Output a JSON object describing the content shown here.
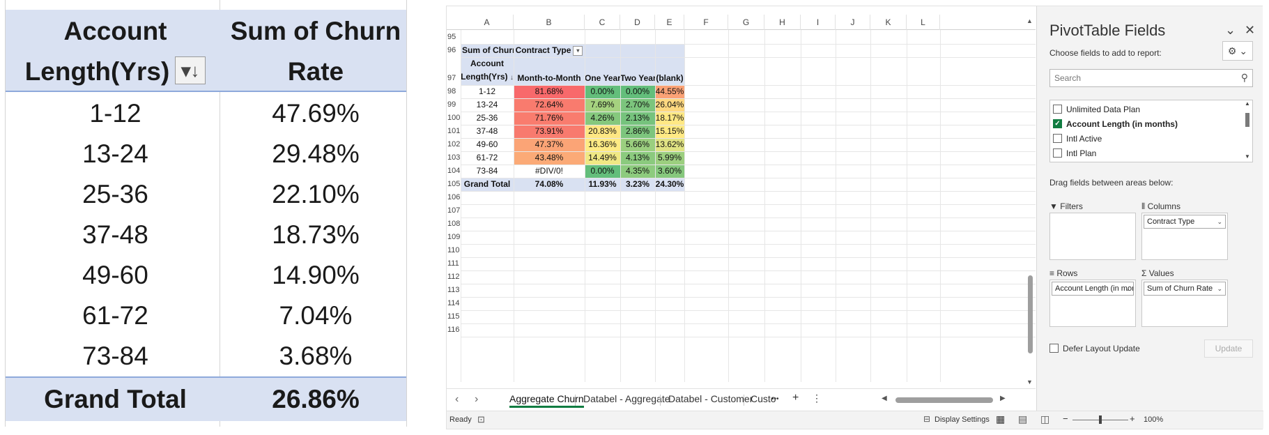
{
  "left_pivot": {
    "header_col1": "Account Length(Yrs)",
    "header_col1_line1": "Account",
    "header_col1_line2": "Length(Yrs)",
    "header_col2_line1": "Sum of Churn",
    "header_col2_line2": "Rate",
    "sort_icon": "sort-descending-icon",
    "rows": [
      {
        "label": "1-12",
        "value": "47.69%"
      },
      {
        "label": "13-24",
        "value": "29.48%"
      },
      {
        "label": "25-36",
        "value": "22.10%"
      },
      {
        "label": "37-48",
        "value": "18.73%"
      },
      {
        "label": "49-60",
        "value": "14.90%"
      },
      {
        "label": "61-72",
        "value": "7.04%"
      },
      {
        "label": "73-84",
        "value": "3.68%"
      }
    ],
    "total_label": "Grand Total",
    "total_value": "26.86%"
  },
  "excel": {
    "columns": [
      "A",
      "B",
      "C",
      "D",
      "E",
      "F",
      "G",
      "H",
      "I",
      "J",
      "K",
      "L"
    ],
    "row_numbers": [
      "95",
      "96",
      "97",
      "98",
      "99",
      "100",
      "101",
      "102",
      "103",
      "104",
      "105",
      "106",
      "107",
      "108",
      "109",
      "110",
      "111",
      "112",
      "113",
      "114",
      "115",
      "116"
    ],
    "pivot": {
      "corner_label": "Sum of Churn Rate",
      "col_field_label": "Contract Type",
      "row_field_label_line1": "Account",
      "row_field_label_line2": "Length(Yrs)",
      "col_headers": [
        "Month-to-Month",
        "One Year",
        "Two Year",
        "(blank)"
      ],
      "rows": [
        {
          "label": "1-12",
          "values": [
            "81.68%",
            "0.00%",
            "0.00%",
            "44.55%"
          ],
          "colors": [
            "#f8696b",
            "#63be7b",
            "#63be7b",
            "#fba276"
          ]
        },
        {
          "label": "13-24",
          "values": [
            "72.64%",
            "7.69%",
            "2.70%",
            "26.04%"
          ],
          "colors": [
            "#f97b6e",
            "#a5d27f",
            "#7cc57d",
            "#fed880"
          ]
        },
        {
          "label": "25-36",
          "values": [
            "71.76%",
            "4.26%",
            "2.13%",
            "18.17%"
          ],
          "colors": [
            "#f97c6e",
            "#85c87d",
            "#76c37d",
            "#ffe884"
          ]
        },
        {
          "label": "37-48",
          "values": [
            "73.91%",
            "20.83%",
            "2.86%",
            "15.15%"
          ],
          "colors": [
            "#f87a6e",
            "#fee783",
            "#7dc57d",
            "#ffea84"
          ]
        },
        {
          "label": "49-60",
          "values": [
            "47.37%",
            "16.36%",
            "5.66%",
            "13.62%"
          ],
          "colors": [
            "#fba476",
            "#ffeb84",
            "#9bcf7f",
            "#e0e383"
          ]
        },
        {
          "label": "61-72",
          "values": [
            "43.48%",
            "14.49%",
            "4.13%",
            "5.99%"
          ],
          "colors": [
            "#fbaa77",
            "#f0e884",
            "#8bca7e",
            "#9ccf7f"
          ]
        },
        {
          "label": "73-84",
          "values": [
            "#DIV/0!",
            "0.00%",
            "4.35%",
            "3.60%"
          ],
          "colors": [
            "#ffffff",
            "#63be7b",
            "#8dcb7e",
            "#86c87d"
          ]
        }
      ],
      "total_label": "Grand Total",
      "total_values": [
        "74.08%",
        "11.93%",
        "3.23%",
        "24.30%"
      ]
    },
    "tabs": [
      "Aggregate Churn",
      "Databel - Aggregate",
      "Databel - Customer",
      "Custo"
    ],
    "active_tab": "Aggregate Churn",
    "tab_more": "•••",
    "tab_add": "+",
    "tab_menu": "⋮",
    "status": {
      "ready": "Ready",
      "display_settings": "Display Settings",
      "zoom": "100%"
    }
  },
  "pane": {
    "title": "PivotTable Fields",
    "subtitle": "Choose fields to add to report:",
    "search_placeholder": "Search",
    "fields": [
      {
        "label": "Unlimited Data Plan",
        "checked": false
      },
      {
        "label": "Account Length (in months)",
        "checked": true
      },
      {
        "label": "Intl Active",
        "checked": false
      },
      {
        "label": "Intl Plan",
        "checked": false
      }
    ],
    "drag_label": "Drag fields between areas below:",
    "areas": {
      "filters": "Filters",
      "columns": "Columns",
      "rows": "Rows",
      "values": "Values",
      "columns_chip": "Contract Type",
      "rows_chip": "Account Length (in mon...",
      "values_chip": "Sum of Churn Rate"
    },
    "defer_label": "Defer Layout Update",
    "update_label": "Update"
  }
}
